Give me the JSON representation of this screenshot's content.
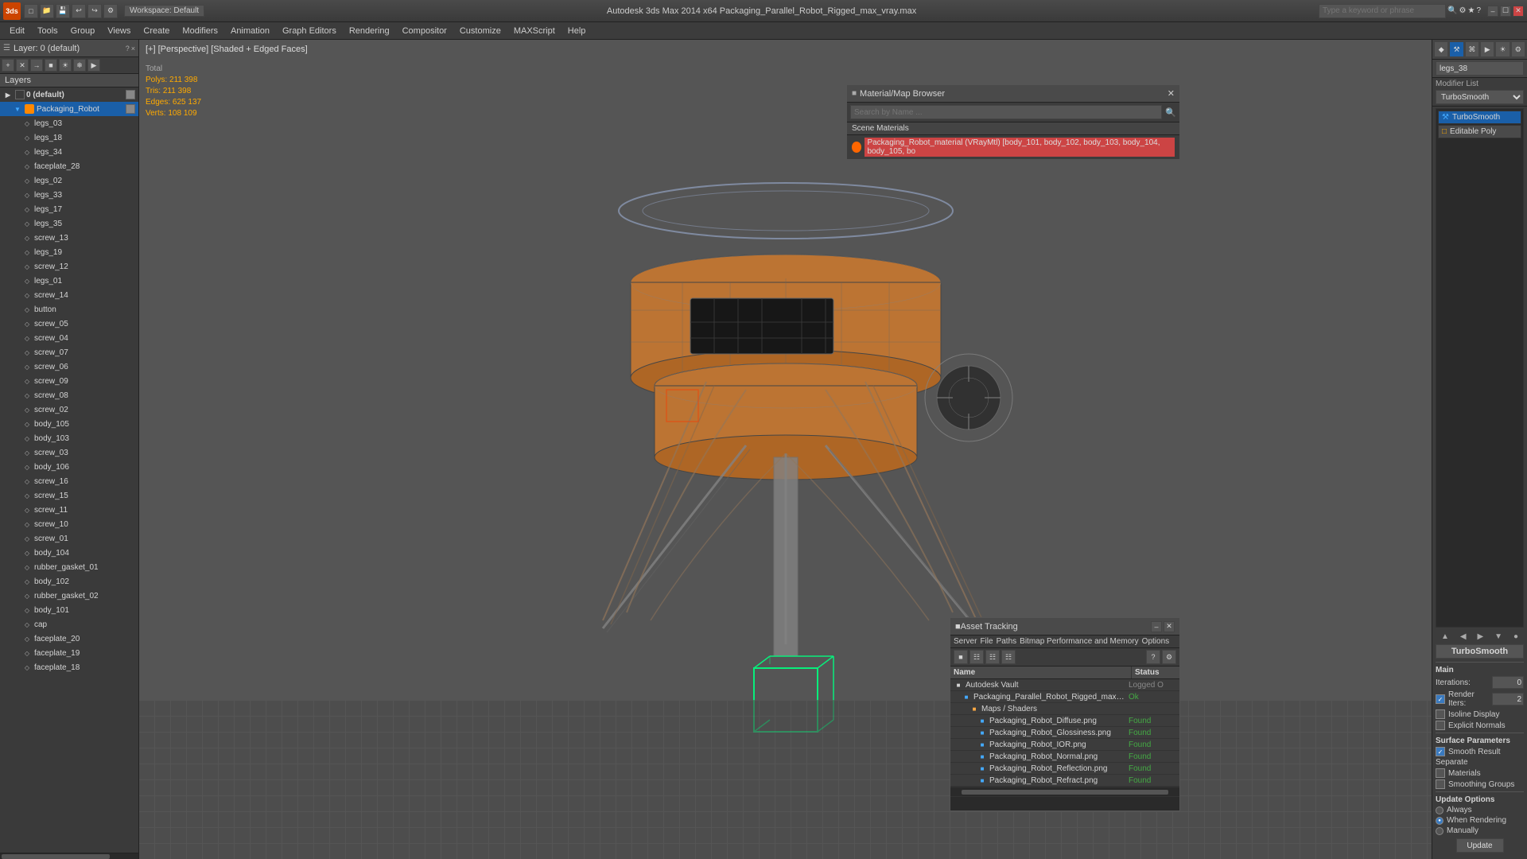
{
  "app": {
    "title": "Autodesk 3ds Max 2014 x64    Packaging_Parallel_Robot_Rigged_max_vray.max",
    "logo": "3",
    "search_placeholder": "Type a keyword or phrase"
  },
  "toolbar": {
    "workspace_label": "Workspace: Default"
  },
  "menu": {
    "items": [
      "Edit",
      "Tools",
      "Group",
      "Views",
      "Create",
      "Modifiers",
      "Animation",
      "Graph Editors",
      "Rendering",
      "Compositor",
      "Customize",
      "MAXScript",
      "Help"
    ]
  },
  "viewport": {
    "label": "[+] [Perspective] [Shaded + Edged Faces]",
    "stats": {
      "polys_label": "Polys:",
      "polys_value": "211 398",
      "tris_label": "Tris:",
      "tris_value": "211 398",
      "edges_label": "Edges:",
      "edges_value": "625 137",
      "verts_label": "Verts:",
      "verts_value": "108 109"
    }
  },
  "layers_panel": {
    "title": "Layer: 0 (default)",
    "layers_label": "Layers",
    "help_btn": "?",
    "close_btn": "×",
    "items": [
      {
        "id": "layer0",
        "name": "0 (default)",
        "level": 0,
        "is_default": true
      },
      {
        "id": "packaging_robot",
        "name": "Packaging_Robot",
        "level": 0,
        "selected": true
      },
      {
        "id": "legs_03",
        "name": "legs_03",
        "level": 1
      },
      {
        "id": "legs_18",
        "name": "legs_18",
        "level": 1
      },
      {
        "id": "legs_34",
        "name": "legs_34",
        "level": 1
      },
      {
        "id": "faceplate_28",
        "name": "faceplate_28",
        "level": 1
      },
      {
        "id": "legs_02",
        "name": "legs_02",
        "level": 1
      },
      {
        "id": "legs_33",
        "name": "legs_33",
        "level": 1
      },
      {
        "id": "legs_17",
        "name": "legs_17",
        "level": 1
      },
      {
        "id": "legs_35",
        "name": "legs_35",
        "level": 1
      },
      {
        "id": "screw_13",
        "name": "screw_13",
        "level": 1
      },
      {
        "id": "legs_19",
        "name": "legs_19",
        "level": 1
      },
      {
        "id": "screw_12",
        "name": "screw_12",
        "level": 1
      },
      {
        "id": "legs_01",
        "name": "legs_01",
        "level": 1
      },
      {
        "id": "screw_14",
        "name": "screw_14",
        "level": 1
      },
      {
        "id": "button",
        "name": "button",
        "level": 1
      },
      {
        "id": "screw_05",
        "name": "screw_05",
        "level": 1
      },
      {
        "id": "screw_04",
        "name": "screw_04",
        "level": 1
      },
      {
        "id": "screw_07",
        "name": "screw_07",
        "level": 1
      },
      {
        "id": "screw_06",
        "name": "screw_06",
        "level": 1
      },
      {
        "id": "screw_09",
        "name": "screw_09",
        "level": 1
      },
      {
        "id": "screw_08",
        "name": "screw_08",
        "level": 1
      },
      {
        "id": "screw_02",
        "name": "screw_02",
        "level": 1
      },
      {
        "id": "body_105",
        "name": "body_105",
        "level": 1
      },
      {
        "id": "body_103",
        "name": "body_103",
        "level": 1
      },
      {
        "id": "screw_03",
        "name": "screw_03",
        "level": 1
      },
      {
        "id": "body_106",
        "name": "body_106",
        "level": 1
      },
      {
        "id": "screw_16",
        "name": "screw_16",
        "level": 1
      },
      {
        "id": "screw_15",
        "name": "screw_15",
        "level": 1
      },
      {
        "id": "screw_11",
        "name": "screw_11",
        "level": 1
      },
      {
        "id": "screw_10",
        "name": "screw_10",
        "level": 1
      },
      {
        "id": "screw_01",
        "name": "screw_01",
        "level": 1
      },
      {
        "id": "body_104",
        "name": "body_104",
        "level": 1
      },
      {
        "id": "rubber_gasket_01",
        "name": "rubber_gasket_01",
        "level": 1
      },
      {
        "id": "body_102",
        "name": "body_102",
        "level": 1
      },
      {
        "id": "rubber_gasket_02",
        "name": "rubber_gasket_02",
        "level": 1
      },
      {
        "id": "body_101",
        "name": "body_101",
        "level": 1
      },
      {
        "id": "cap",
        "name": "cap",
        "level": 1
      },
      {
        "id": "faceplate_20",
        "name": "faceplate_20",
        "level": 1
      },
      {
        "id": "faceplate_19",
        "name": "faceplate_19",
        "level": 1
      },
      {
        "id": "faceplate_18",
        "name": "faceplate_18",
        "level": 1
      }
    ]
  },
  "modifier_panel": {
    "object_name": "legs_38",
    "modifier_list_label": "Modifier List",
    "modifiers": [
      "TurboSmooth",
      "Editable Poly"
    ]
  },
  "turbosmooth": {
    "title": "TurboSmooth",
    "main_label": "Main",
    "iterations_label": "Iterations:",
    "iterations_value": "0",
    "render_iters_label": "Render Iters:",
    "render_iters_value": "2",
    "render_iters_checked": true,
    "isoline_label": "Isoline Display",
    "explicit_normals_label": "Explicit Normals",
    "surface_params_label": "Surface Parameters",
    "smooth_result_label": "Smooth Result",
    "smooth_result_checked": true,
    "separate_label": "Separate",
    "materials_label": "Materials",
    "smoothing_groups_label": "Smoothing Groups",
    "update_options_label": "Update Options",
    "always_label": "Always",
    "when_rendering_label": "When Rendering",
    "manually_label": "Manually",
    "update_btn": "Update",
    "always_selected": false,
    "when_rendering_selected": true,
    "manually_selected": false
  },
  "mat_browser": {
    "title": "Material/Map Browser",
    "search_placeholder": "Search by Name ...",
    "scene_materials_label": "Scene Materials",
    "material_name": "Packaging_Robot_material (VRayMtl) [body_101, body_102, body_103, body_104, body_105, bo"
  },
  "asset_tracking": {
    "title": "Asset Tracking",
    "menu_items": [
      "Server",
      "File",
      "Paths",
      "Bitmap Performance and Memory",
      "Options"
    ],
    "col_name": "Name",
    "col_status": "Status",
    "items": [
      {
        "name": "Autodesk Vault",
        "level": 0,
        "icon": "vault",
        "status": "Logged O"
      },
      {
        "name": "Packaging_Parallel_Robot_Rigged_max_vray.max",
        "level": 1,
        "icon": "max",
        "status": "Ok"
      },
      {
        "name": "Maps / Shaders",
        "level": 2,
        "icon": "folder",
        "status": ""
      },
      {
        "name": "Packaging_Robot_Diffuse.png",
        "level": 3,
        "icon": "file",
        "status": "Found"
      },
      {
        "name": "Packaging_Robot_Glossiness.png",
        "level": 3,
        "icon": "file",
        "status": "Found"
      },
      {
        "name": "Packaging_Robot_IOR.png",
        "level": 3,
        "icon": "file",
        "status": "Found"
      },
      {
        "name": "Packaging_Robot_Normal.png",
        "level": 3,
        "icon": "file",
        "status": "Found"
      },
      {
        "name": "Packaging_Robot_Reflection.png",
        "level": 3,
        "icon": "file",
        "status": "Found"
      },
      {
        "name": "Packaging_Robot_Refract.png",
        "level": 3,
        "icon": "file",
        "status": "Found"
      }
    ]
  }
}
